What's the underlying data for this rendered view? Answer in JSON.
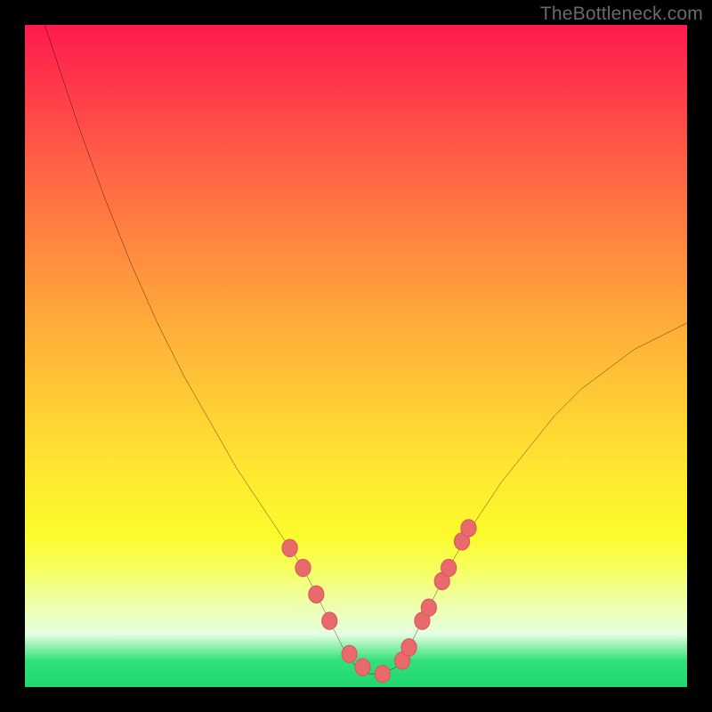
{
  "watermark": "TheBottleneck.com",
  "colors": {
    "frame": "#000000",
    "curve_stroke": "#000000",
    "marker_fill": "#e96a6c",
    "marker_stroke": "#d65a5c",
    "gradient_top": "#ff1a4d",
    "gradient_bottom": "#1ed86e"
  },
  "chart_data": {
    "type": "line",
    "title": "",
    "xlabel": "",
    "ylabel": "",
    "xlim": [
      0,
      100
    ],
    "ylim": [
      0,
      100
    ],
    "series": [
      {
        "name": "bottleneck-curve",
        "x": [
          3,
          5,
          8,
          12,
          16,
          20,
          24,
          28,
          32,
          36,
          40,
          42,
          44,
          46,
          48,
          50,
          52,
          54,
          56,
          58,
          60,
          64,
          68,
          72,
          76,
          80,
          84,
          88,
          92,
          96,
          100
        ],
        "y": [
          100,
          94,
          85,
          74,
          64,
          55,
          47,
          40,
          33,
          27,
          21,
          18,
          14,
          10,
          6,
          3,
          2,
          2,
          3,
          6,
          10,
          18,
          25,
          31,
          36,
          41,
          45,
          48,
          51,
          53,
          55
        ]
      }
    ],
    "markers": {
      "name": "highlight-dots",
      "x": [
        40,
        42,
        44,
        46,
        49,
        51,
        54,
        57,
        58,
        60,
        61,
        63,
        64,
        66,
        67
      ],
      "y": [
        21,
        18,
        14,
        10,
        5,
        3,
        2,
        4,
        6,
        10,
        12,
        16,
        18,
        22,
        24
      ]
    }
  }
}
